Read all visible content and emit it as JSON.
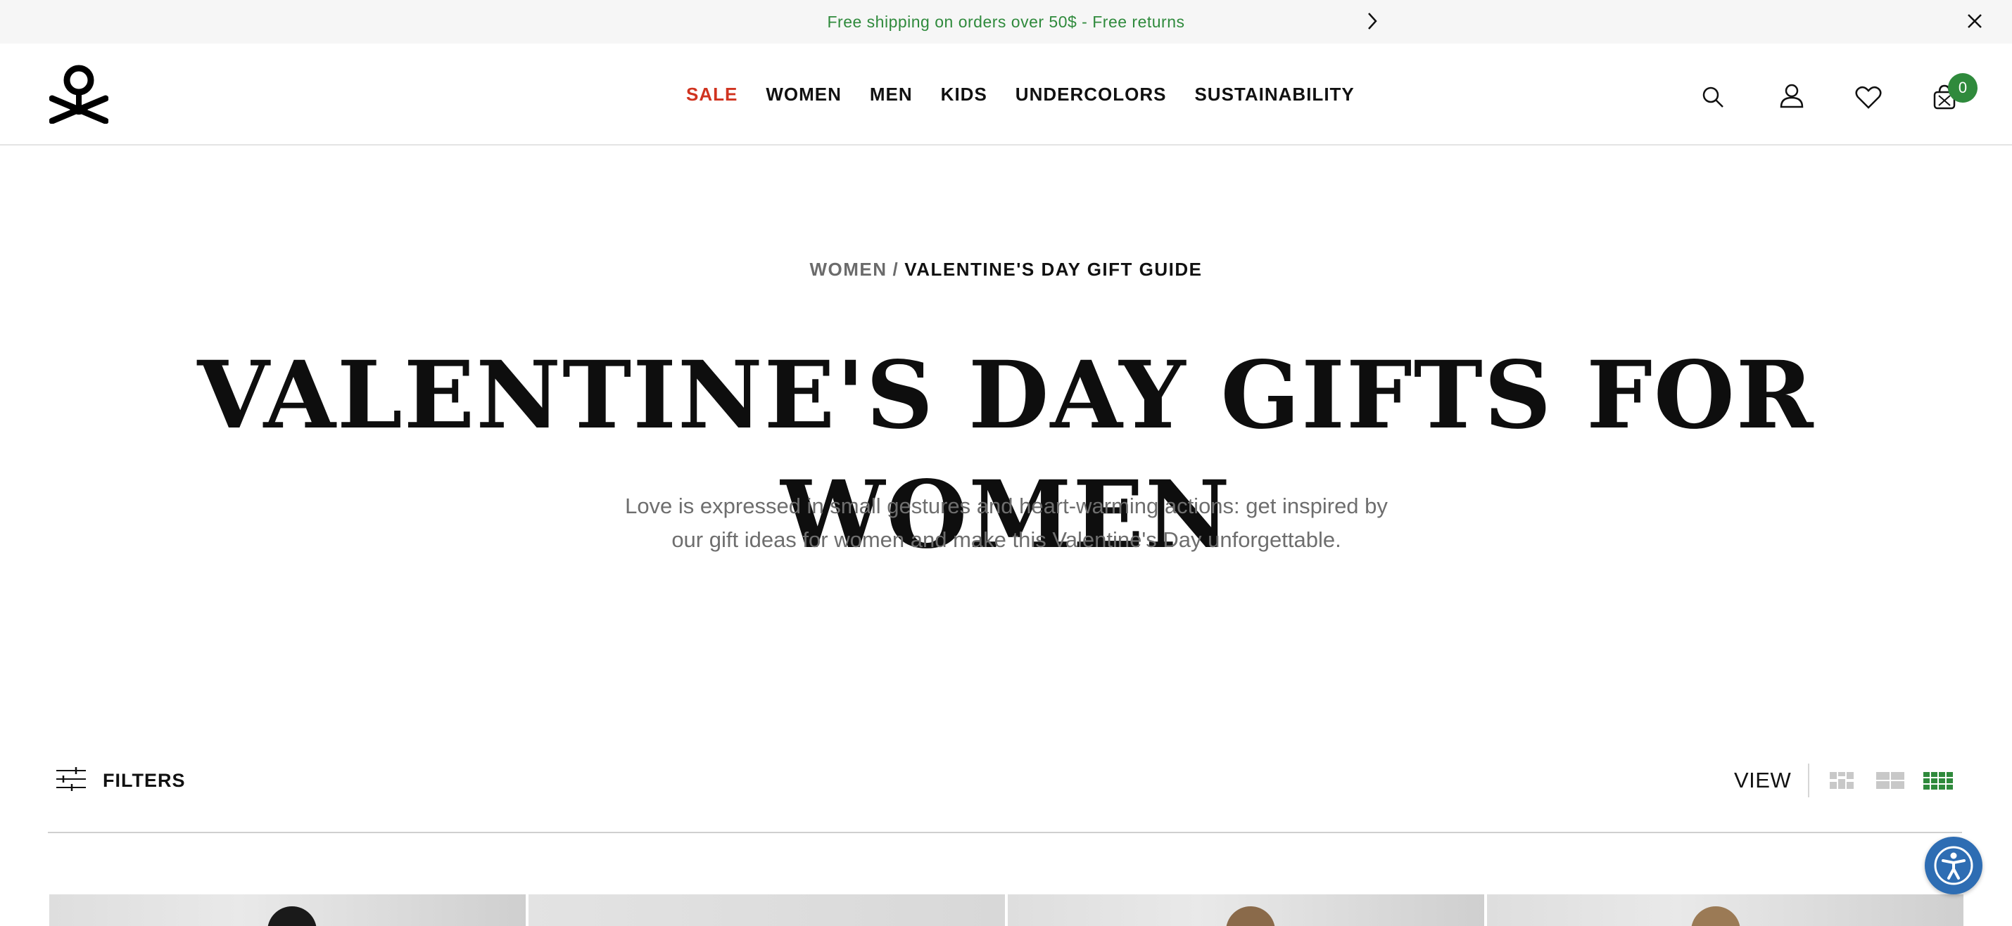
{
  "promo": {
    "text": "Free shipping on orders over 50$ - Free returns",
    "next_icon": "chevron-right-icon",
    "close_icon": "close-icon"
  },
  "header": {
    "logo_icon": "brand-logo-icon",
    "nav": [
      {
        "label": "SALE",
        "highlight": true
      },
      {
        "label": "WOMEN"
      },
      {
        "label": "MEN"
      },
      {
        "label": "KIDS"
      },
      {
        "label": "UNDERCOLORS"
      },
      {
        "label": "SUSTAINABILITY"
      }
    ],
    "icons": [
      "search-icon",
      "user-icon",
      "heart-icon",
      "bag-icon"
    ],
    "cart_count": "0"
  },
  "breadcrumb": {
    "parent": "WOMEN",
    "separator": "/",
    "current": "VALENTINE'S DAY GIFT GUIDE"
  },
  "hero": {
    "title": "VALENTINE'S DAY GIFTS FOR WOMEN",
    "subtitle": "Love is expressed in small gestures and heart-warming actions: get inspired by our gift ideas for women and make this Valentine's Day unforgettable."
  },
  "toolbar": {
    "filters_label": "FILTERS",
    "view_label": "VIEW",
    "view_options": [
      "grid-small-icon",
      "grid-medium-icon",
      "grid-large-icon"
    ],
    "active_view": "grid-large-icon"
  },
  "colors": {
    "accent_green": "#2f8a3c",
    "sale_red": "#d0331f",
    "accessibility_blue": "#2e6db3"
  }
}
